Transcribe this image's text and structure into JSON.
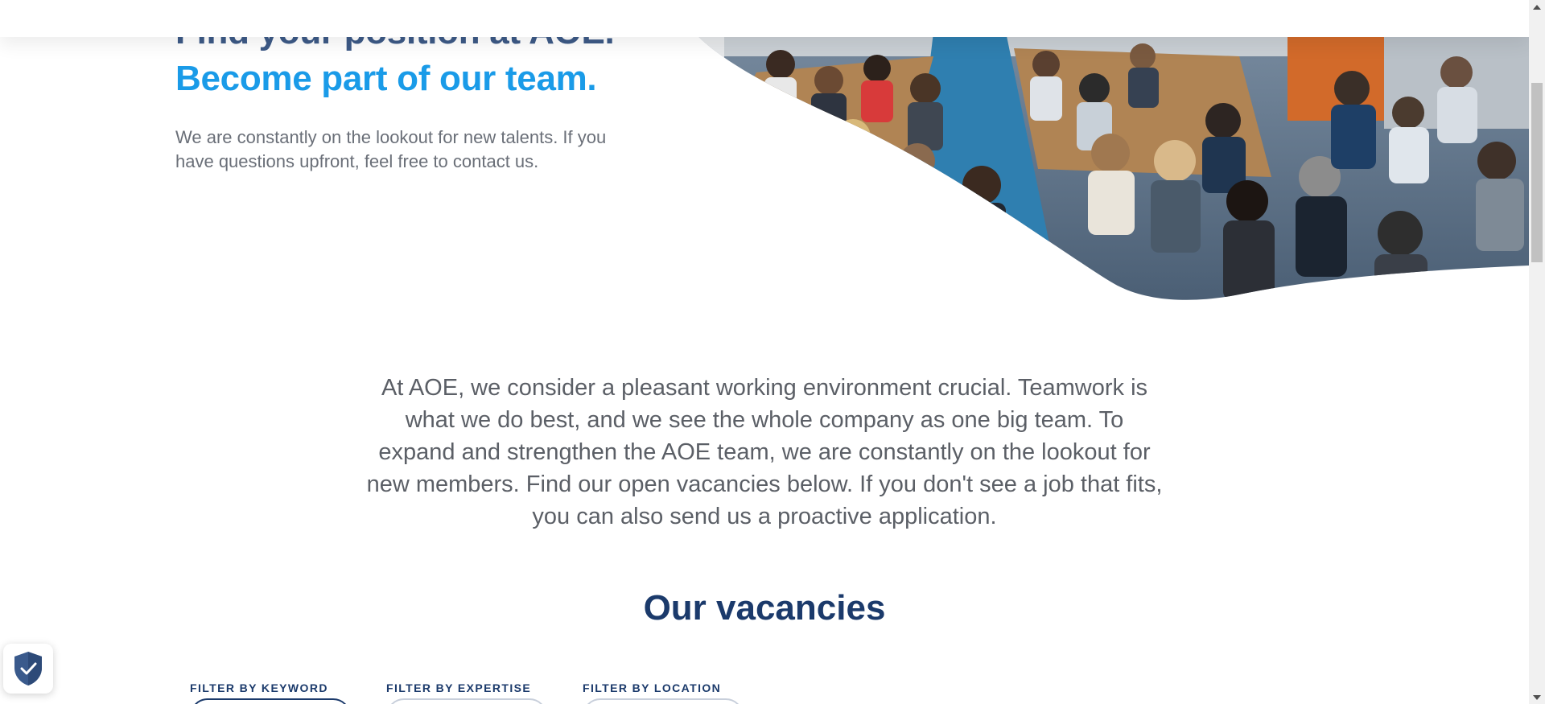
{
  "hero": {
    "title_line1": "Find your position at AOE.",
    "title_line2": "Become part of our team.",
    "subtitle": "We are constantly on the lookout for new talents. If you have questions upfront, feel free to contact us."
  },
  "intro": {
    "text": "At AOE, we consider a pleasant working environment crucial. Teamwork is what we do best, and we see the whole company as one big team. To expand and strengthen the AOE team, we are constantly on the lookout for new members. Find our open vacancies below. If you don't see a job that fits, you can also send us a proactive application."
  },
  "vacancies": {
    "title": "Our vacancies",
    "filters": [
      {
        "label": "FILTER BY KEYWORD"
      },
      {
        "label": "FILTER BY EXPERTISE"
      },
      {
        "label": "FILTER BY LOCATION"
      }
    ]
  },
  "icons": {
    "privacy_badge": "shield-check-icon",
    "scroll_up": "triangle-up-icon",
    "scroll_down": "triangle-down-icon"
  },
  "colors": {
    "title_dark": "#3d5a87",
    "title_accent": "#1a9be8",
    "heading_navy": "#1b3a6b",
    "body_text": "#5b5f66"
  }
}
